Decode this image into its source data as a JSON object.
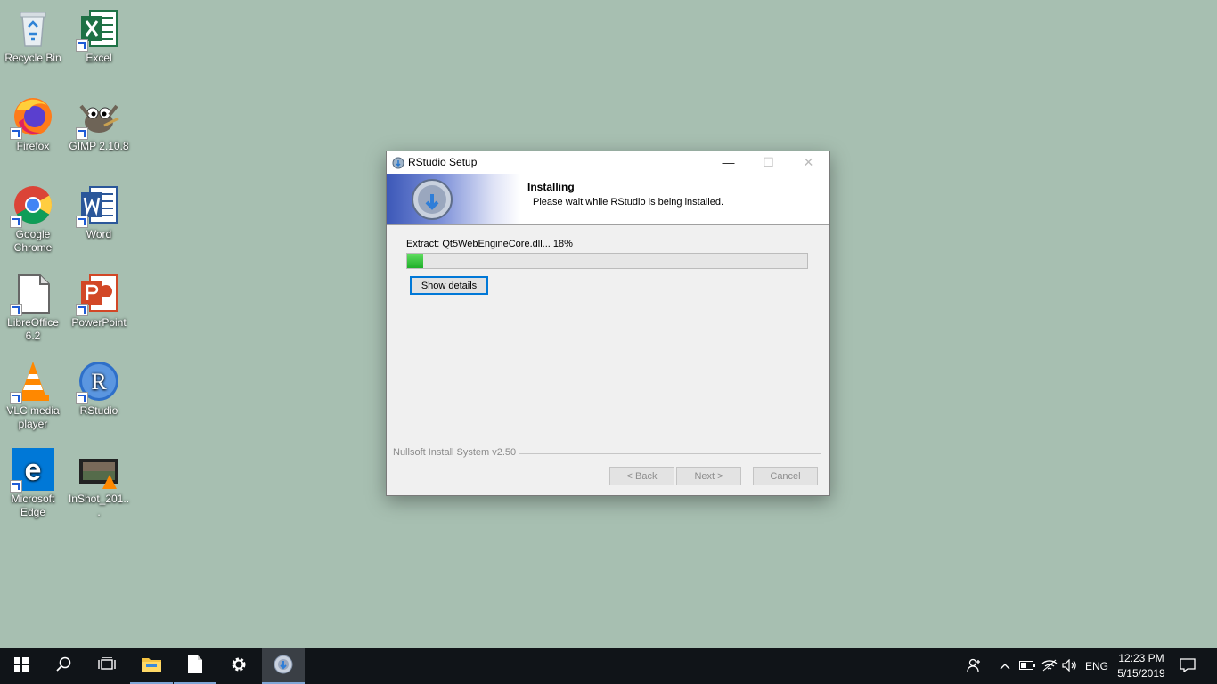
{
  "desktop": {
    "icons": [
      {
        "label": "Recycle Bin"
      },
      {
        "label": "Excel"
      },
      {
        "label": "Firefox"
      },
      {
        "label": "GIMP 2.10.8"
      },
      {
        "label": "Google Chrome"
      },
      {
        "label": "Word"
      },
      {
        "label": "LibreOffice 6.2"
      },
      {
        "label": "PowerPoint"
      },
      {
        "label": "VLC media player"
      },
      {
        "label": "RStudio"
      },
      {
        "label": "Microsoft Edge"
      },
      {
        "label": "InShot_201..."
      }
    ]
  },
  "dialog": {
    "title": "RStudio Setup",
    "header_title": "Installing",
    "header_subtitle": "Please wait while RStudio is being installed.",
    "extract_text": "Extract: Qt5WebEngineCore.dll... 18%",
    "progress_fraction": 0.04,
    "show_details_label": "Show details",
    "branding": "Nullsoft Install System v2.50",
    "back_label": "< Back",
    "next_label": "Next >",
    "cancel_label": "Cancel"
  },
  "taskbar": {
    "language": "ENG",
    "time": "12:23 PM",
    "date": "5/15/2019"
  },
  "colors": {
    "desktop_bg": "#a7bfb1",
    "taskbar_bg": "#101418",
    "progress": "#1fb02a",
    "focus": "#0078d7"
  }
}
